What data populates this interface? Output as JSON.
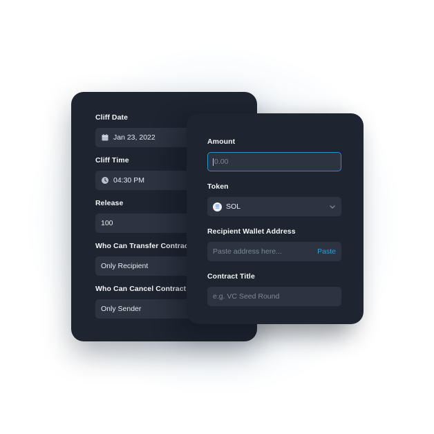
{
  "back_form": {
    "cliff_date": {
      "label": "Cliff Date",
      "value": "Jan 23, 2022",
      "icon": "calendar-icon"
    },
    "cliff_time": {
      "label": "Cliff Time",
      "value": "04:30 PM",
      "icon": "clock-icon"
    },
    "release": {
      "label": "Release",
      "value": "100"
    },
    "transfer": {
      "label": "Who Can Transfer Contract?",
      "value": "Only Recipient"
    },
    "cancel": {
      "label": "Who Can Cancel Contract?",
      "value": "Only Sender"
    }
  },
  "front_form": {
    "amount": {
      "label": "Amount",
      "placeholder": "0.00"
    },
    "token": {
      "label": "Token",
      "value": "SOL",
      "icon": "solana-icon"
    },
    "recipient": {
      "label": "Recipient Wallet Address",
      "placeholder": "Paste address here...",
      "action": "Paste"
    },
    "title": {
      "label": "Contract Title",
      "placeholder": "e.g. VC Seed Round"
    }
  },
  "colors": {
    "card_bg": "#1e2430",
    "field_bg": "#2c3441",
    "accent": "#2ea1db",
    "focus_border": "#2a8fc7"
  }
}
